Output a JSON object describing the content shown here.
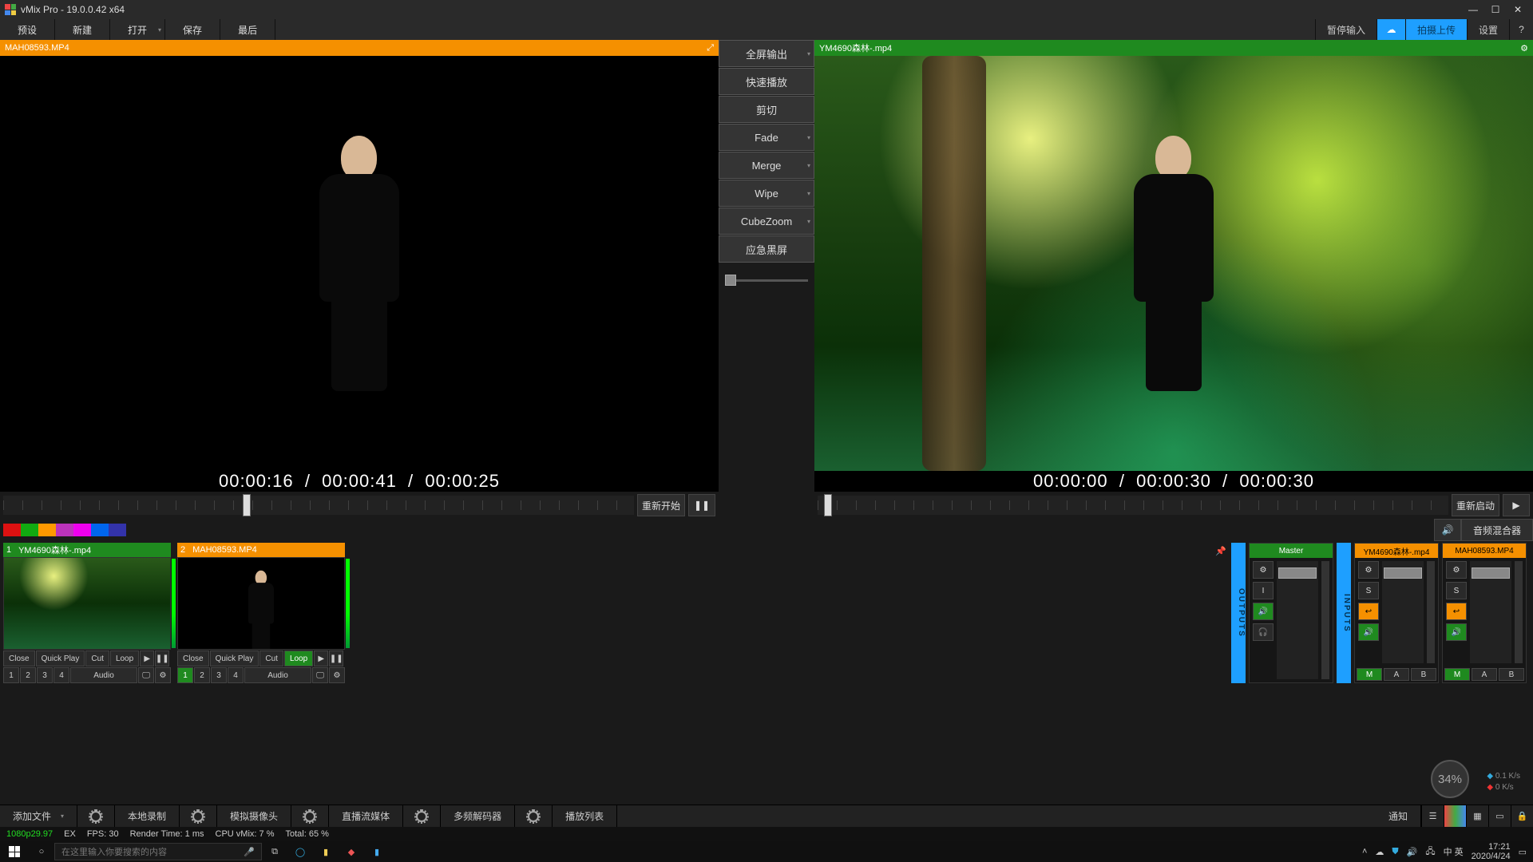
{
  "app": {
    "title": "vMix Pro - 19.0.0.42 x64"
  },
  "menu": {
    "items": [
      "预设",
      "新建",
      "打开",
      "保存",
      "最后"
    ],
    "pause_input": "暂停输入",
    "upload": "拍摄上传",
    "settings": "设置",
    "help": "?"
  },
  "preview": {
    "title": "MAH08593.MP4",
    "time_current": "00:00:16",
    "time_total": "00:00:41",
    "time_remain": "00:00:25",
    "restart": "重新开始"
  },
  "output": {
    "title": "YM4690森林-.mp4",
    "time_current": "00:00:00",
    "time_total": "00:00:30",
    "time_remain": "00:00:30",
    "restart": "重新启动"
  },
  "transitions": {
    "fullscreen": "全屏输出",
    "quickplay": "快速播放",
    "cut": "剪切",
    "fade": "Fade",
    "merge": "Merge",
    "wipe": "Wipe",
    "cubezoom": "CubeZoom",
    "ftb": "应急黑屏"
  },
  "color_swatches": [
    "#d11",
    "#1a1",
    "#f90",
    "#b3b",
    "#e0e",
    "#06e",
    "#33a"
  ],
  "inputs": [
    {
      "num": "1",
      "title": "YM4690森林-.mp4",
      "hdr": "green",
      "thumb": "forest",
      "loop_on": false,
      "active_overlay": null
    },
    {
      "num": "2",
      "title": "MAH08593.MP4",
      "hdr": "orange",
      "thumb": "person",
      "loop_on": true,
      "active_overlay": "1"
    }
  ],
  "input_buttons": {
    "close": "Close",
    "quickplay": "Quick Play",
    "cut": "Cut",
    "loop": "Loop",
    "audio": "Audio"
  },
  "mixer": {
    "outputs_label": "OUTPUTS",
    "inputs_label": "INPUTS",
    "channels": [
      {
        "name": "Master",
        "hdr": "master",
        "m": true
      },
      {
        "name": "YM4690森林-.mp4",
        "hdr": "orange",
        "m": true
      },
      {
        "name": "MAH08593.MP4",
        "hdr": "orange",
        "m": true
      }
    ],
    "btn_s": "S",
    "btn_m": "M",
    "btn_a": "A",
    "btn_b": "B",
    "btn_i": "I"
  },
  "fps_bubble": "34%",
  "net": {
    "up": "0.1 K/s",
    "down": "0 K/s"
  },
  "footer": {
    "add": "添加文件",
    "items": [
      "本地录制",
      "模拟摄像头",
      "直播流媒体",
      "多频解码器",
      "播放列表"
    ],
    "right_label": "通知"
  },
  "status": {
    "fmt": "1080p29.97",
    "ex": "EX",
    "fps_label": "FPS:",
    "fps": "30",
    "render_label": "Render Time:",
    "render": "1 ms",
    "cpu_label": "CPU vMix:",
    "cpu": "7 %",
    "total_label": "Total:",
    "total": "65 %"
  },
  "taskbar": {
    "search_placeholder": "在这里输入你要搜索的内容",
    "ime": "中 英",
    "time": "17:21",
    "date": "2020/4/24"
  },
  "mixer_label": "音频混合器"
}
